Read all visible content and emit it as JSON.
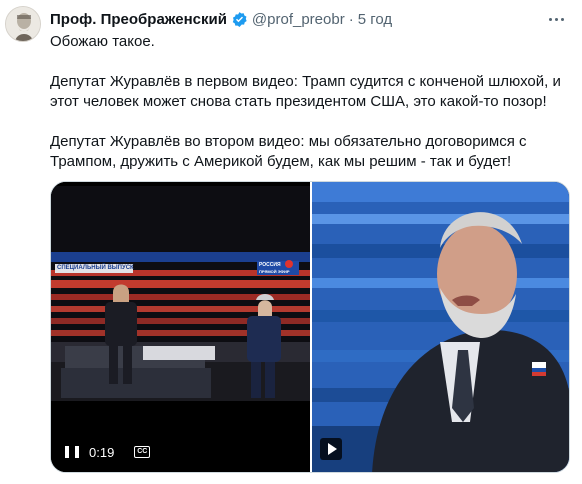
{
  "tweet": {
    "author_name": "Проф. Преображенский",
    "handle": "@prof_preobr",
    "separator": "·",
    "time": "5 год",
    "lines": [
      "Обожаю такое.",
      "Депутат Журавлёв в первом видео: Трамп судится с конченой шлюхой, и",
      "этот человек может снова стать президентом США, это какой-то позор!",
      "Депутат Журавлёв во втором видео: мы обязательно договоримся с",
      "Трампом, дружить с Америкой будем, как мы решим - так и будет!"
    ]
  },
  "media": {
    "video_time": "0:19",
    "cc_label": "CC",
    "left_banner": "СПЕЦИАЛЬНЫЙ ВЫПУСК",
    "channel_logo_line1": "РОССИЯ",
    "channel_logo_line2": "ПРЯМОЙ ЭФИР"
  },
  "icons": {
    "verified": "verified-badge-icon",
    "more": "more-dots-icon",
    "pause": "pause-icon",
    "cc": "closed-captions-icon",
    "play": "play-icon"
  },
  "colors": {
    "verified": "#1d9bf0",
    "text": "#0f1419",
    "muted": "#536471",
    "border": "#cfd9de"
  }
}
